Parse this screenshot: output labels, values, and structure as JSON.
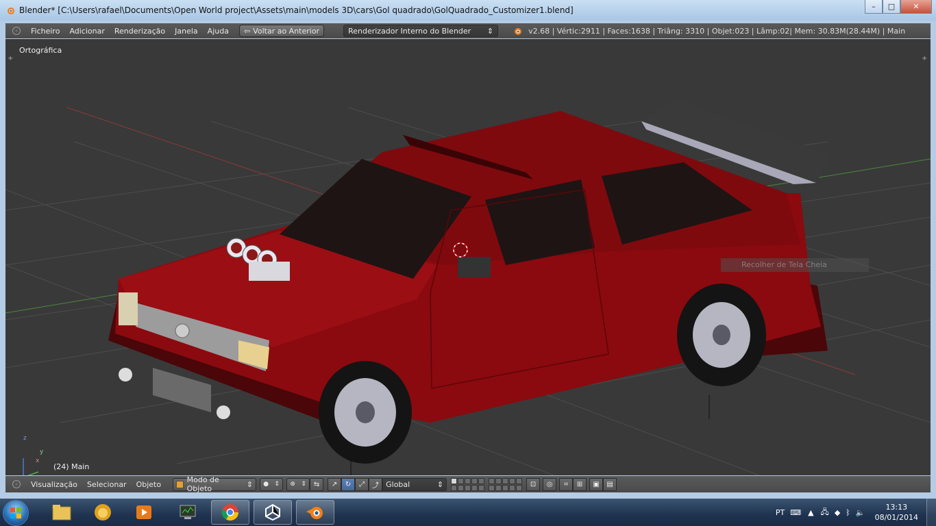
{
  "window": {
    "title": "Blender* [C:\\Users\\rafael\\Documents\\Open World project\\Assets\\main\\models 3D\\cars\\Gol quadrado\\GolQuadrado_Customizer1.blend]",
    "controls": {
      "minimize": "–",
      "maximize": "□",
      "close": "✕"
    }
  },
  "info_header": {
    "menus": [
      "Ficheiro",
      "Adicionar",
      "Renderização",
      "Janela",
      "Ajuda"
    ],
    "back_button": "Voltar ao Anterior",
    "renderer": "Renderizador Interno do Blender",
    "stats": "v2.68 | Vértic:2911 | Faces:1638 | Triâng: 3310 | Objet:023 | Lâmp:02| Mem: 30.83M(28.44M) | Main"
  },
  "viewport": {
    "view_label": "Ortográfica",
    "object_label": "(24) Main",
    "ghost_tooltip": "Recolher de Tela Cheia",
    "axes": {
      "x": "x",
      "y": "y",
      "z": "z"
    },
    "car_color": "#8a0a0f"
  },
  "view_header": {
    "menus": [
      "Visualização",
      "Selecionar",
      "Objeto"
    ],
    "mode": "Modo de Objeto",
    "orientation": "Global"
  },
  "taskbar": {
    "apps": [
      "explorer-icon",
      "lion-app-icon",
      "media-player-icon",
      "task-manager-icon",
      "chrome-icon",
      "unity-icon",
      "blender-icon"
    ],
    "language": "PT",
    "time": "13:13",
    "date": "08/01/2014"
  }
}
